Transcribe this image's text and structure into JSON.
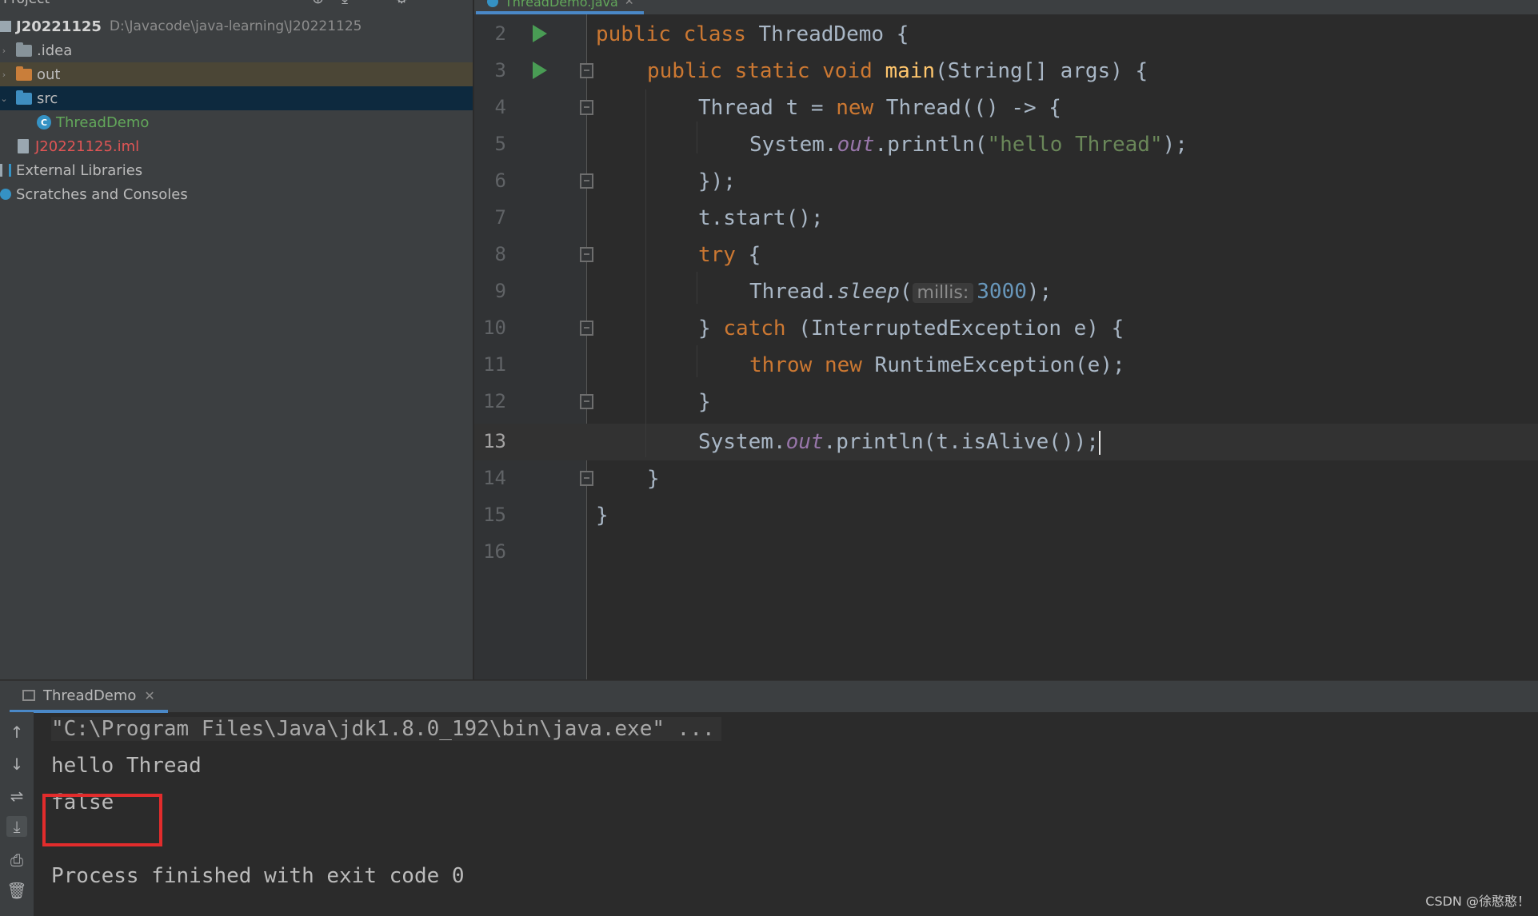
{
  "project_panel": {
    "title": "Project",
    "tree": [
      {
        "label": "J20221125",
        "path": "D:\\Javacode\\java-learning\\J20221125"
      },
      {
        "label": ".idea"
      },
      {
        "label": "out"
      },
      {
        "label": "src"
      },
      {
        "label": "ThreadDemo"
      },
      {
        "label": "J20221125.iml"
      },
      {
        "label": "External Libraries"
      },
      {
        "label": "Scratches and Consoles"
      }
    ]
  },
  "editor": {
    "tab_label": "ThreadDemo.java",
    "line_numbers": [
      "2",
      "3",
      "4",
      "5",
      "6",
      "7",
      "8",
      "9",
      "10",
      "11",
      "12",
      "13",
      "14",
      "15",
      "16"
    ],
    "current_line": "13",
    "param_hint": "millis:",
    "code": {
      "l2": {
        "kw1": "public",
        "kw2": "class",
        "name": "ThreadDemo {"
      },
      "l3": {
        "kw1": "public",
        "kw2": "static",
        "kw3": "void",
        "fn": "main",
        "rest": "(String[] args) {"
      },
      "l4": {
        "a": "Thread t = ",
        "kw": "new",
        "b": " Thread(() -> {"
      },
      "l5": {
        "a": "System.",
        "field": "out",
        "b": ".println(",
        "str": "\"hello Thread\"",
        "c": ");"
      },
      "l6": {
        "a": "});"
      },
      "l7": {
        "a": "t.start();"
      },
      "l8": {
        "kw": "try",
        "a": " {"
      },
      "l9": {
        "a": "Thread.",
        "m": "sleep",
        "b": "(",
        "num": "3000",
        "c": ");"
      },
      "l10": {
        "a": "} ",
        "kw": "catch",
        "b": " (InterruptedException e) {"
      },
      "l11": {
        "kw1": "throw",
        "kw2": "new",
        "a": " RuntimeException(e);"
      },
      "l12": {
        "a": "}"
      },
      "l13": {
        "a": "System.",
        "field": "out",
        "b": ".println(t.isAlive());"
      },
      "l14": {
        "a": "}"
      },
      "l15": {
        "a": "}"
      }
    }
  },
  "run_panel": {
    "tab_label": "ThreadDemo",
    "console": [
      "\"C:\\Program Files\\Java\\jdk1.8.0_192\\bin\\java.exe\" ...",
      "hello Thread",
      "false",
      "Process finished with exit code 0"
    ]
  },
  "watermark": "CSDN @徐憨憨！",
  "colors": {
    "background": "#2b2b2b",
    "panel": "#3c3f41",
    "keyword": "#cc7832",
    "string": "#6a8759",
    "number": "#6897bb",
    "field": "#9876aa",
    "highlight_box": "#e22c2c"
  }
}
